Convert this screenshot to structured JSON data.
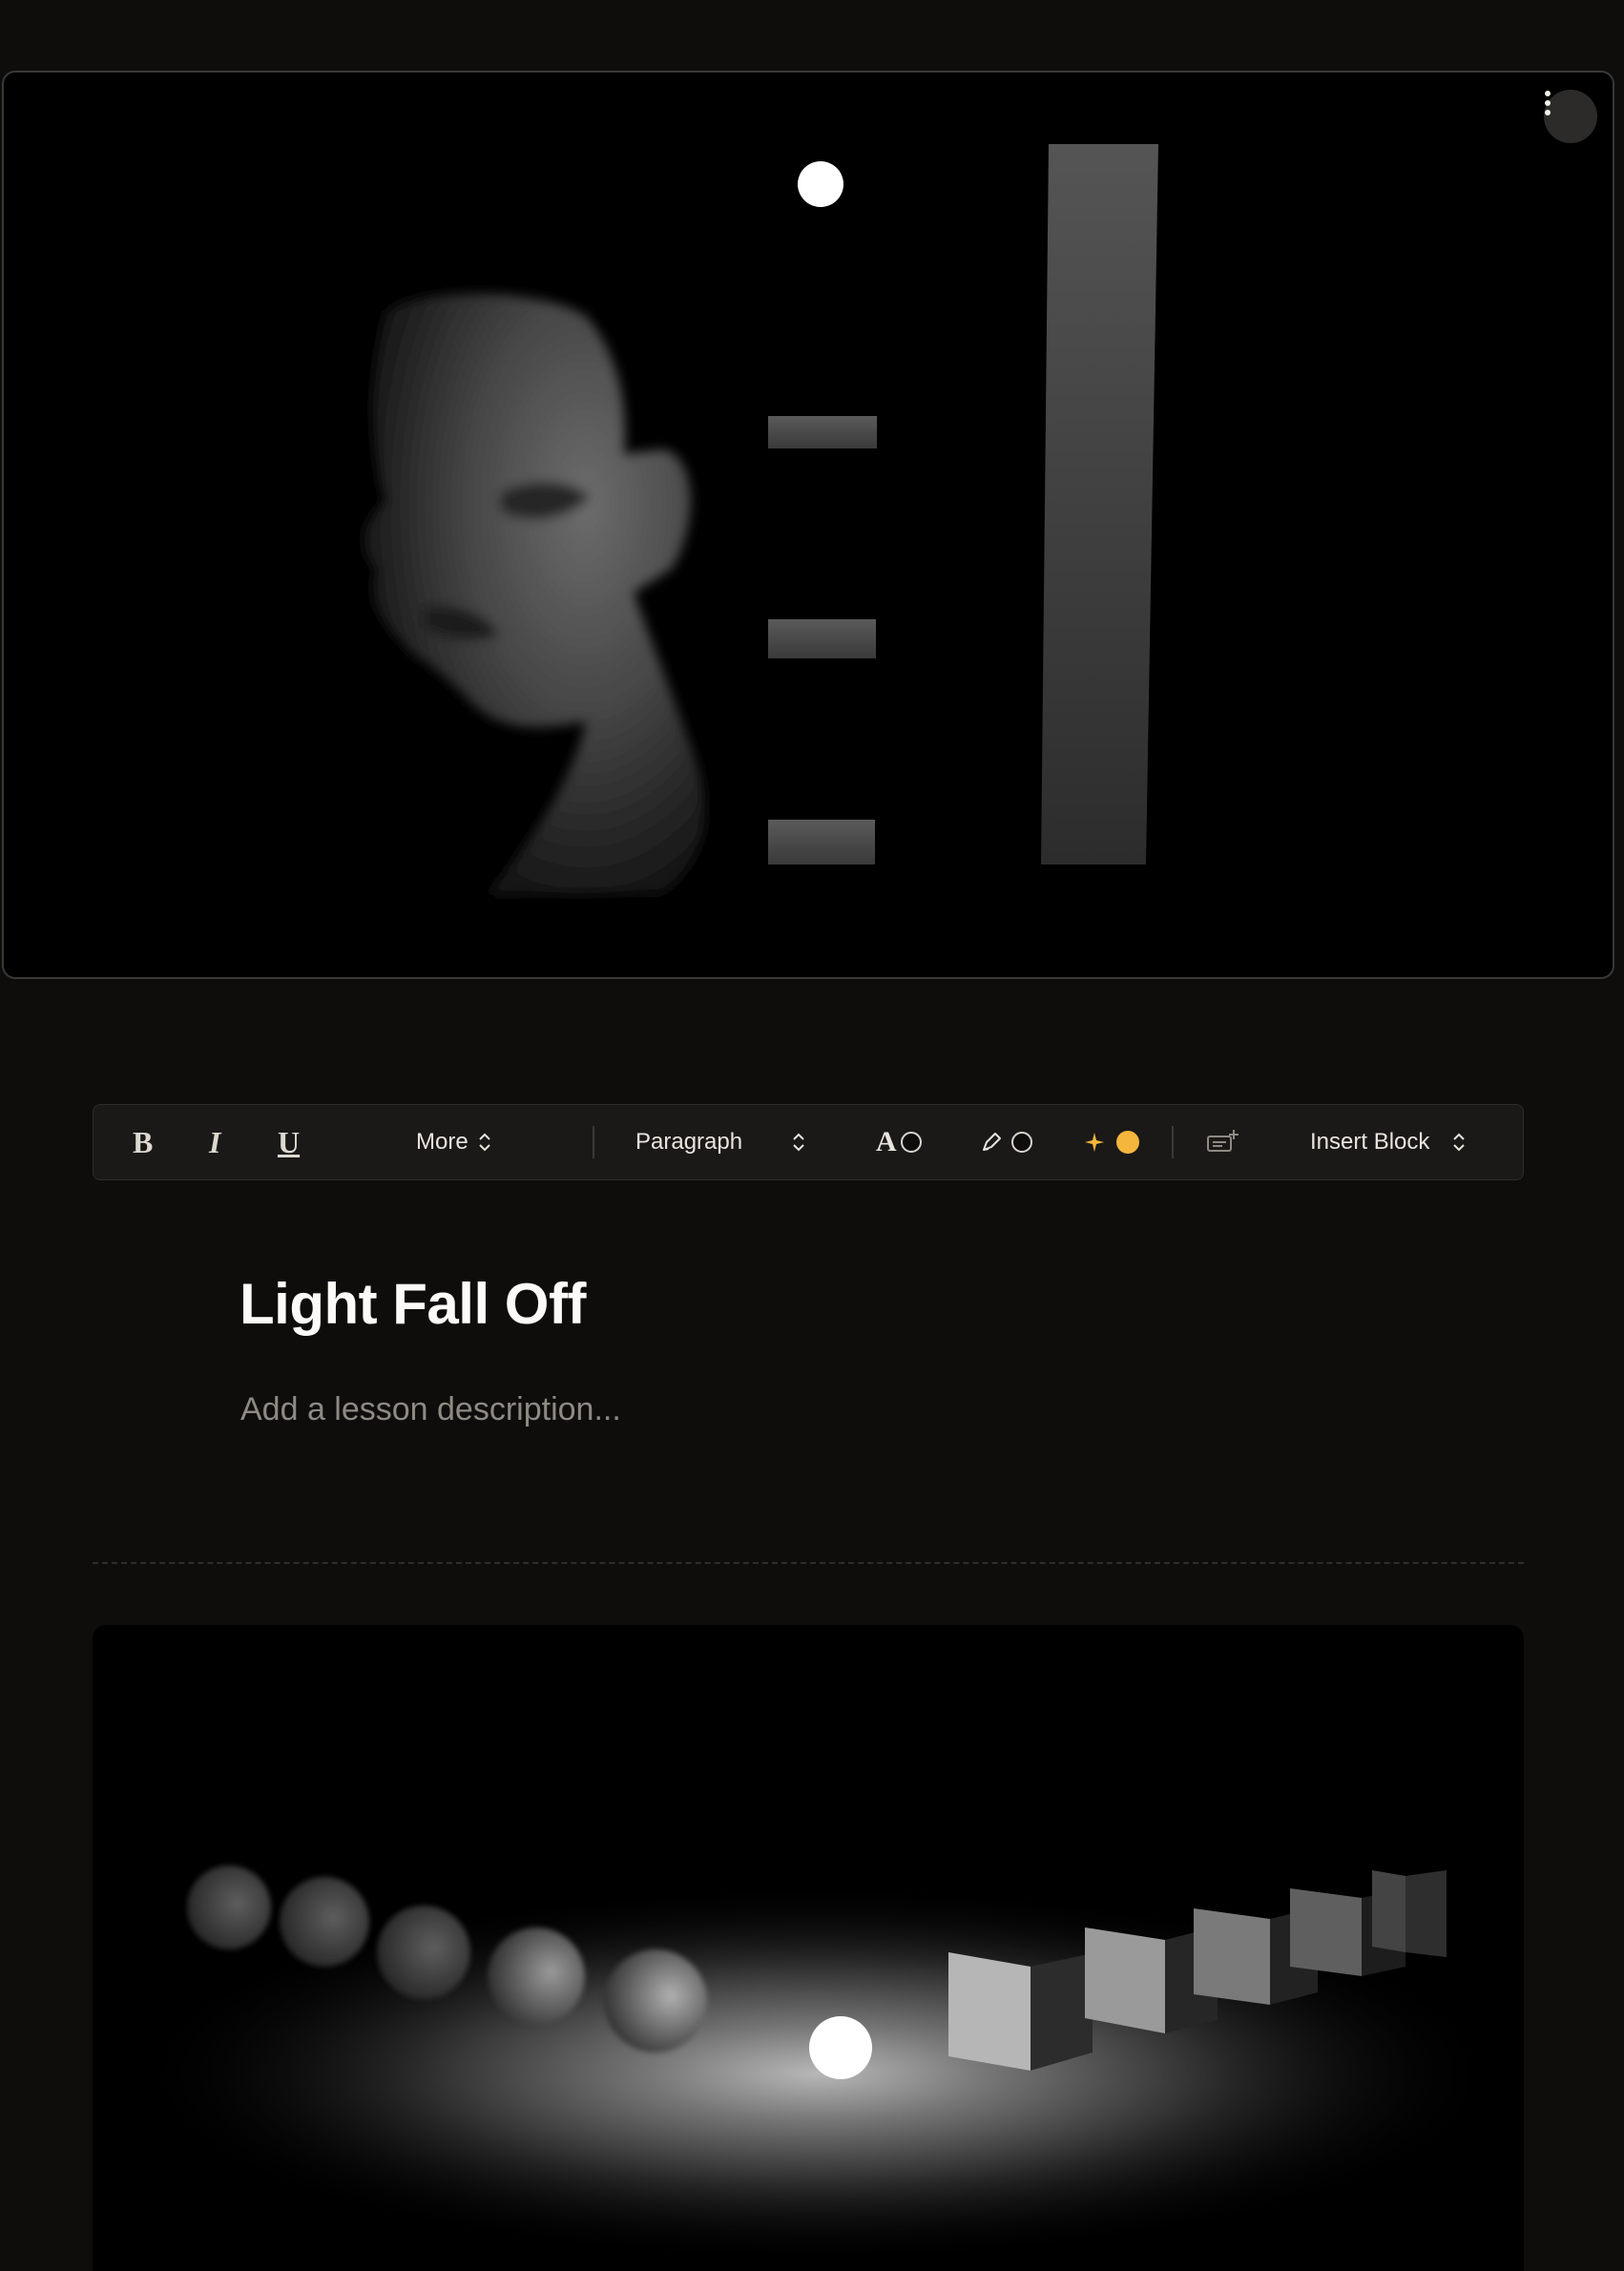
{
  "hero": {
    "menu_icon": "more-vertical-icon"
  },
  "toolbar": {
    "bold_label": "B",
    "italic_label": "I",
    "underline_label": "U",
    "more_label": "More",
    "block_type_label": "Paragraph",
    "text_color_glyph": "A",
    "text_color": "#0e0d0c",
    "highlight_color": "#0e0d0c",
    "ai_color": "#f4b63c",
    "insert_block_label": "Insert Block",
    "icons": [
      "bold-icon",
      "italic-icon",
      "underline-icon",
      "chevron-updown-icon",
      "text-color-icon",
      "highlighter-icon",
      "sparkles-icon",
      "comment-add-icon"
    ]
  },
  "lesson": {
    "title": "Light Fall Off",
    "description_placeholder": "Add a lesson description..."
  }
}
